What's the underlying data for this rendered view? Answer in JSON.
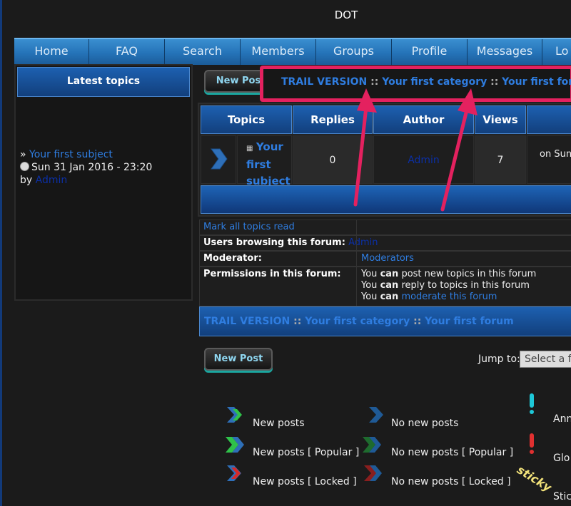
{
  "site": {
    "title": "DOT"
  },
  "nav": [
    "Home",
    "FAQ",
    "Search",
    "Members",
    "Groups",
    "Profile",
    "Messages",
    "Lo"
  ],
  "latest": {
    "title": "Latest topics",
    "prefix": "»",
    "topic": "Your first subject",
    "date": "Sun 31 Jan 2016 - 23:20",
    "by_label": "by",
    "author": "Admin"
  },
  "buttons": {
    "new_post": "New Post",
    "new_post_partial": "New Pos"
  },
  "breadcrumb": {
    "root": "TRAIL VERSION",
    "sep": "::",
    "category": "Your first category",
    "forum": "Your first forum"
  },
  "topics_table": {
    "headers": [
      "Topics",
      "Replies",
      "Author",
      "Views",
      ""
    ],
    "row": {
      "title_lines": [
        "Your",
        "first",
        "subject"
      ],
      "replies": "0",
      "author": "Admin",
      "views": "7",
      "last_post": "on Sun"
    }
  },
  "info": {
    "mark_read": "Mark all topics read",
    "users_browsing_label": "Users browsing this forum:",
    "users_browsing_value": "Admin",
    "moderator_label": "Moderator:",
    "moderator_value": "Moderators",
    "permissions_label": "Permissions in this forum:",
    "perm1_pre": "You",
    "perm1_can": "can",
    "perm1_post": "post new topics in this forum",
    "perm2_pre": "You",
    "perm2_can": "can",
    "perm2_post": "reply to topics in this forum",
    "perm3_pre": "You",
    "perm3_can": "can",
    "perm3_link": "moderate this forum"
  },
  "jump": {
    "label": "Jump to:",
    "selected": "Select a f"
  },
  "legend": {
    "new_posts": "New posts",
    "no_new_posts": "No new posts",
    "new_popular": "New posts [ Popular ]",
    "no_new_popular": "No new posts [ Popular ]",
    "new_locked": "New posts [ Locked ]",
    "no_new_locked": "No new posts [ Locked ]",
    "announcement": "Ann",
    "global": "Glo",
    "sticky": "Stic",
    "sticky_badge": "sticky"
  },
  "colors": {
    "highlight": "#e4215f",
    "link": "#2f7de0",
    "nav": "#2573b8"
  }
}
